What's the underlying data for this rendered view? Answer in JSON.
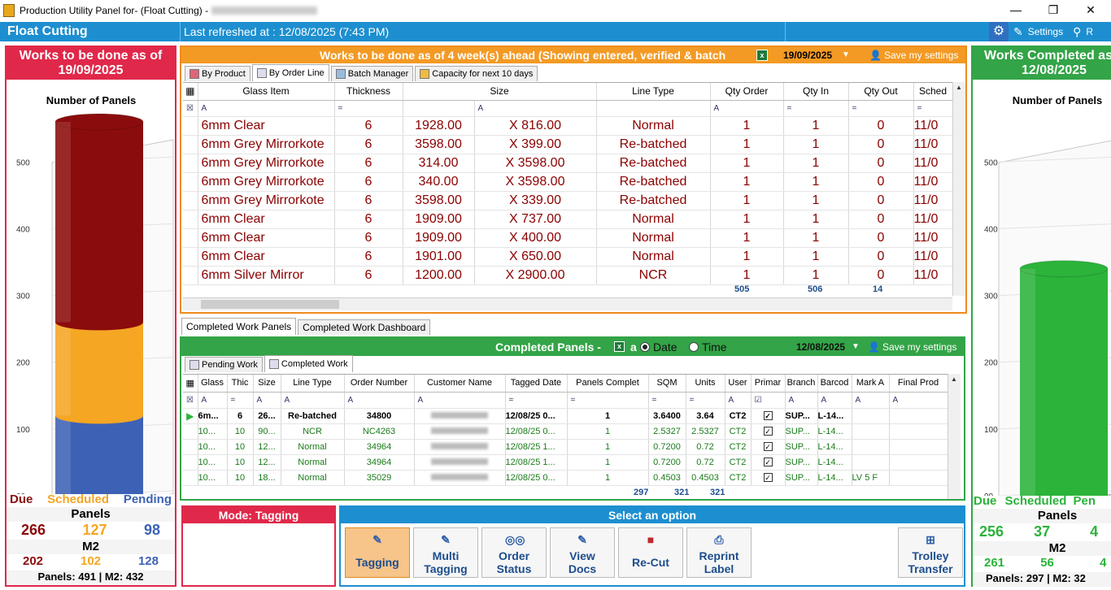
{
  "window": {
    "title": "Production Utility Panel for- (Float Cutting) -",
    "min": "—",
    "restore": "❐",
    "close": "✕"
  },
  "topbar": {
    "section": "Float Cutting",
    "last_refreshed": "Last refreshed at : 12/08/2025 (7:43 PM)",
    "settings": "Settings",
    "right_cut": "R"
  },
  "left_panel": {
    "header_line1": "Works to be done as of",
    "header_line2": "19/09/2025",
    "chart_title": "Number of Panels",
    "labels": {
      "due": "Due",
      "scheduled": "Scheduled",
      "pending": "Pending",
      "panels": "Panels",
      "m2": "M2"
    },
    "panels": {
      "due": "266",
      "scheduled": "127",
      "pending": "98"
    },
    "m2": {
      "due": "202",
      "scheduled": "102",
      "pending": "128"
    },
    "footer": "Panels: 491 | M2: 432"
  },
  "right_panel": {
    "header_line1": "Works Completed as",
    "header_line2": "12/08/2025",
    "chart_title": "Number of Panels",
    "labels": {
      "due": "Due",
      "scheduled": "Scheduled",
      "pending": "Pen",
      "panels": "Panels",
      "m2": "M2"
    },
    "panels": {
      "due": "256",
      "scheduled": "37",
      "pending": "4"
    },
    "m2": {
      "due": "261",
      "scheduled": "56",
      "pending": "4"
    },
    "footer": "Panels: 297 | M2: 32"
  },
  "chart_data": [
    {
      "type": "bar",
      "title": "Number of Panels",
      "categories": [
        "Panels"
      ],
      "series": [
        {
          "name": "Pending",
          "values": [
            120
          ],
          "color": "#3d62b5"
        },
        {
          "name": "Scheduled",
          "values": [
            140
          ],
          "color": "#f5a623"
        },
        {
          "name": "Due",
          "values": [
            300
          ],
          "color": "#8b0c0c"
        }
      ],
      "stacked": true,
      "yticks": [
        "00",
        "100",
        "200",
        "300",
        "400",
        "500"
      ],
      "ylim": [
        0,
        560
      ]
    },
    {
      "type": "bar",
      "title": "Number of Panels",
      "categories": [
        "Panels"
      ],
      "series": [
        {
          "name": "Due",
          "values": [
            340
          ],
          "color": "#2bb33a"
        }
      ],
      "yticks": [
        "00",
        "100",
        "200",
        "300",
        "400",
        "500"
      ],
      "ylim": [
        0,
        560
      ]
    }
  ],
  "orders": {
    "header": "Works to be done as of 4 week(s) ahead   (Showing entered, verified & batch",
    "date": "19/09/2025",
    "save": "Save my settings",
    "tabs": [
      "By Product",
      "By Order Line",
      "Batch Manager",
      "Capacity for next 10 days"
    ],
    "columns": [
      "Glass Item",
      "Thickness",
      "Size",
      "Line Type",
      "Qty Order",
      "Qty In",
      "Qty Out",
      "Sched"
    ],
    "rows": [
      [
        "6mm Clear",
        "6",
        "1928.00",
        "X 816.00",
        "Normal",
        "1",
        "1",
        "0",
        "11/0"
      ],
      [
        "6mm Grey Mirrorkote",
        "6",
        "3598.00",
        "X 399.00",
        "Re-batched",
        "1",
        "1",
        "0",
        "11/0"
      ],
      [
        "6mm Grey Mirrorkote",
        "6",
        "314.00",
        "X 3598.00",
        "Re-batched",
        "1",
        "1",
        "0",
        "11/0"
      ],
      [
        "6mm Grey Mirrorkote",
        "6",
        "340.00",
        "X 3598.00",
        "Re-batched",
        "1",
        "1",
        "0",
        "11/0"
      ],
      [
        "6mm Grey Mirrorkote",
        "6",
        "3598.00",
        "X 339.00",
        "Re-batched",
        "1",
        "1",
        "0",
        "11/0"
      ],
      [
        "6mm Clear",
        "6",
        "1909.00",
        "X 737.00",
        "Normal",
        "1",
        "1",
        "0",
        "11/0"
      ],
      [
        "6mm Clear",
        "6",
        "1909.00",
        "X 400.00",
        "Normal",
        "1",
        "1",
        "0",
        "11/0"
      ],
      [
        "6mm Clear",
        "6",
        "1901.00",
        "X 650.00",
        "Normal",
        "1",
        "1",
        "0",
        "11/0"
      ],
      [
        "6mm Silver Mirror",
        "6",
        "1200.00",
        "X 2900.00",
        "NCR",
        "1",
        "1",
        "0",
        "11/0"
      ]
    ],
    "totals": {
      "qty_order": "505",
      "qty_in": "506",
      "qty_out": "14"
    }
  },
  "completed": {
    "tabs": [
      "Completed Work Panels",
      "Completed Work  Dashboard"
    ],
    "header": "Completed Panels - ",
    "opt_a": "a",
    "date_label": "Date",
    "time_label": "Time",
    "date": "12/08/2025",
    "save": "Save my settings",
    "subtabs": [
      "Pending Work",
      "Completed Work"
    ],
    "columns": [
      "Glass",
      "Thic",
      "Size",
      "Line Type",
      "Order Number",
      "Customer Name",
      "Tagged Date",
      "Panels Complet",
      "SQM",
      "Units",
      "User",
      "Primar",
      "Branch",
      "Barcod",
      "Mark A",
      "Final Prod"
    ],
    "rows": [
      [
        "6m...",
        "6",
        "26...",
        "Re-batched",
        "34800",
        "",
        "12/08/25  0...",
        "1",
        "3.6400",
        "3.64",
        "CT2",
        "SUP...",
        "L-14...",
        ""
      ],
      [
        "10...",
        "10",
        "90...",
        "NCR",
        "NC4263",
        "",
        "12/08/25  0...",
        "1",
        "2.5327",
        "2.5327",
        "CT2",
        "SUP...",
        "L-14...",
        ""
      ],
      [
        "10...",
        "10",
        "12...",
        "Normal",
        "34964",
        "",
        "12/08/25  1...",
        "1",
        "0.7200",
        "0.72",
        "CT2",
        "SUP...",
        "L-14...",
        ""
      ],
      [
        "10...",
        "10",
        "12...",
        "Normal",
        "34964",
        "",
        "12/08/25  1...",
        "1",
        "0.7200",
        "0.72",
        "CT2",
        "SUP...",
        "L-14...",
        ""
      ],
      [
        "10...",
        "10",
        "18...",
        "Normal",
        "35029",
        "",
        "12/08/25  0...",
        "1",
        "0.4503",
        "0.4503",
        "CT2",
        "SUP...",
        "L-14...",
        "LV 5 F"
      ]
    ],
    "totals": {
      "panels": "297",
      "sqm": "321",
      "units": "321"
    }
  },
  "mode": {
    "label": "Mode: Tagging"
  },
  "options": {
    "header": "Select an option",
    "buttons": [
      "Tagging",
      "Multi Tagging",
      "Order Status",
      "View Docs",
      "Re-Cut",
      "Reprint Label",
      "Trolley Transfer"
    ]
  }
}
